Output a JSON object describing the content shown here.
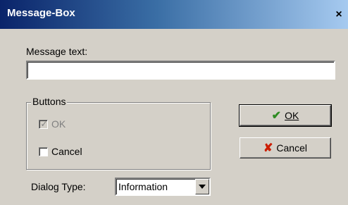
{
  "window": {
    "title": "Message-Box",
    "close_glyph": "×"
  },
  "message": {
    "label": "Message text:",
    "value": ""
  },
  "buttons_group": {
    "legend": "Buttons",
    "ok": {
      "label": "OK",
      "checked": true,
      "enabled": false
    },
    "cancel": {
      "label": "Cancel",
      "checked": false,
      "enabled": true
    }
  },
  "actions": {
    "ok": {
      "label": "OK",
      "icon": "check-icon",
      "icon_glyph": "✔",
      "icon_color": "#2e8b22"
    },
    "cancel": {
      "label": "Cancel",
      "icon": "x-icon",
      "icon_glyph": "✘",
      "icon_color": "#cc1d00"
    }
  },
  "dialog_type": {
    "label": "Dialog Type:",
    "selected": "Information"
  },
  "colors": {
    "face": "#d4d0c8",
    "title_start": "#0a246a",
    "title_end": "#a6caf0"
  }
}
